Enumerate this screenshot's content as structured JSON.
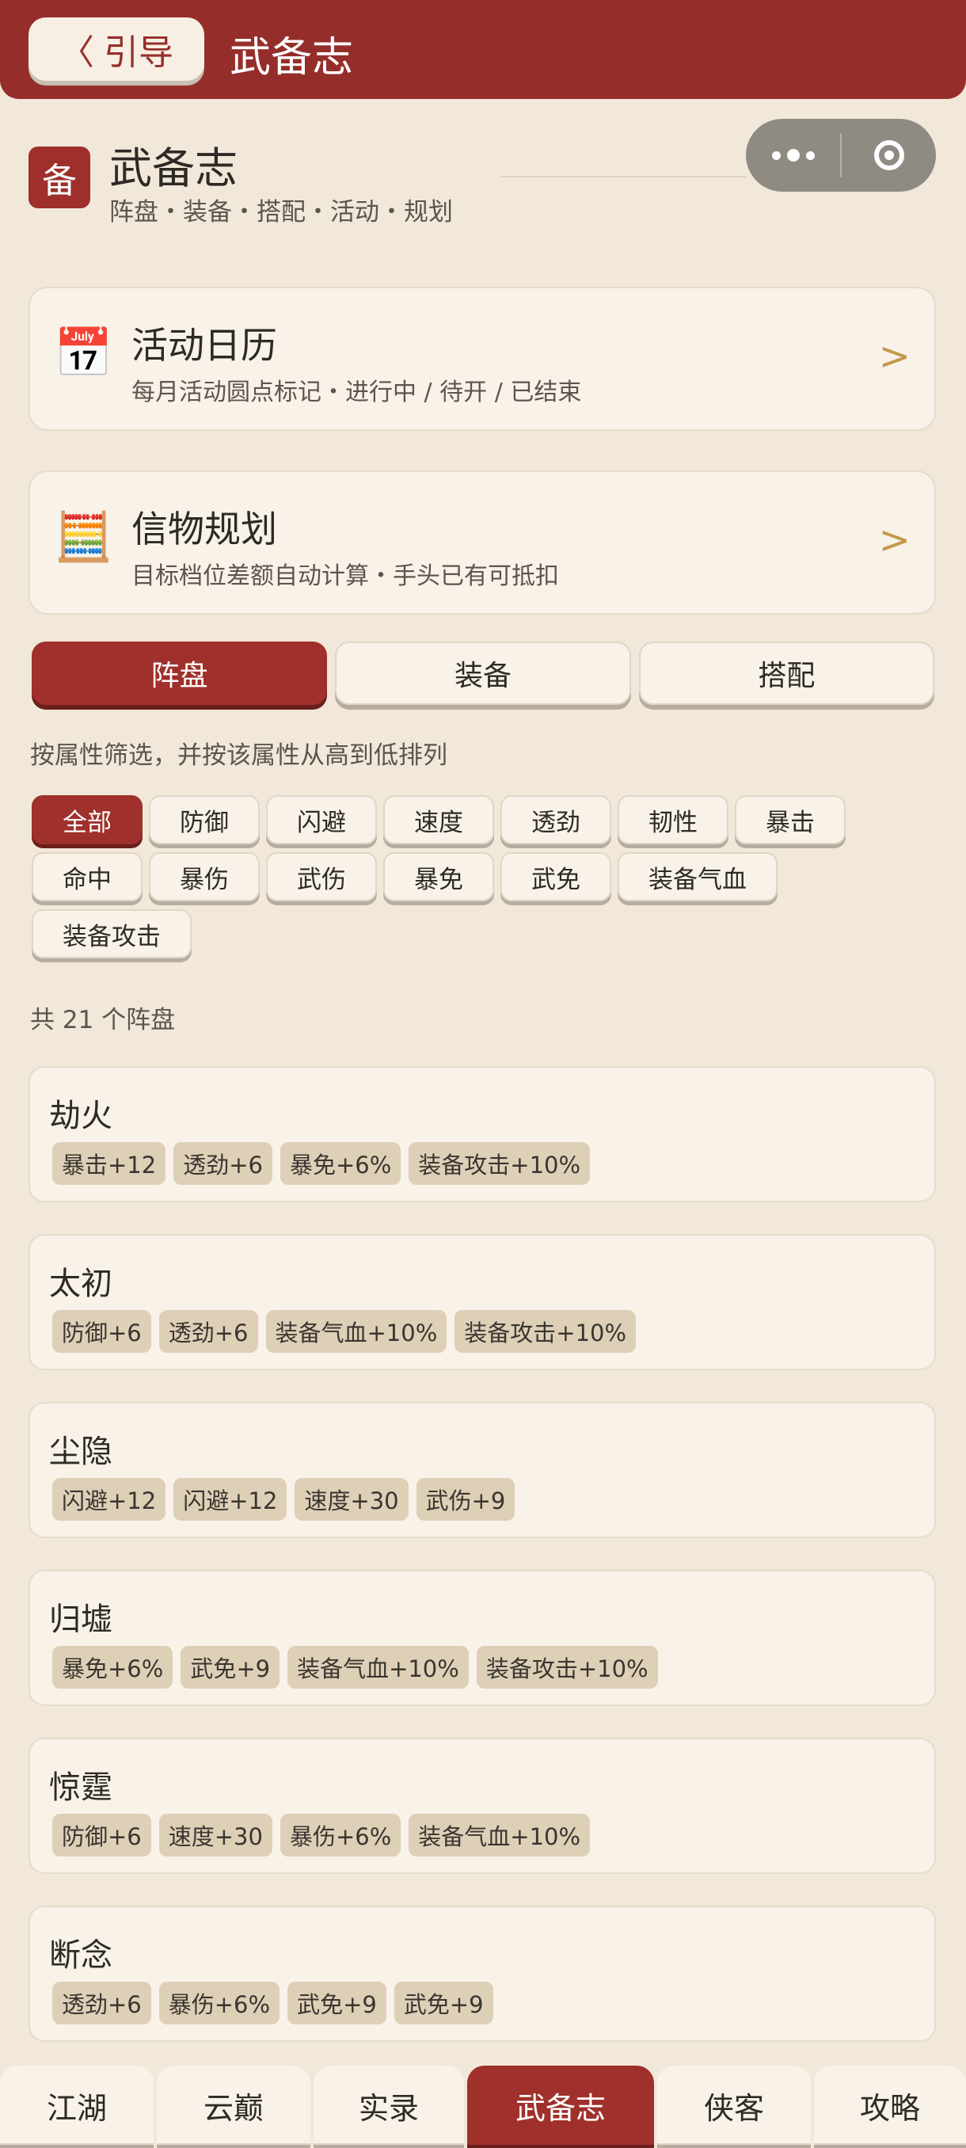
{
  "topbar": {
    "back_glyph": "〈",
    "back_label": "引导",
    "title": "武备志"
  },
  "header": {
    "logo_char": "备",
    "title": "武备志",
    "subtitle": "阵盘・装备・搭配・活动・规划"
  },
  "entries": [
    {
      "icon": "calendar-icon",
      "emoji": "📅",
      "title": "活动日历",
      "subtitle": "每月活动圆点标记・进行中 / 待开 / 已结束",
      "chevron": ">"
    },
    {
      "icon": "abacus-icon",
      "emoji": "🧮",
      "title": "信物规划",
      "subtitle": "目标档位差额自动计算・手头已有可抵扣",
      "chevron": ">"
    }
  ],
  "tabs": [
    {
      "label": "阵盘",
      "active": true
    },
    {
      "label": "装备",
      "active": false
    },
    {
      "label": "搭配",
      "active": false
    }
  ],
  "hint": "按属性筛选，并按该属性从高到低排列",
  "filters": [
    {
      "label": "全部",
      "active": true
    },
    {
      "label": "防御"
    },
    {
      "label": "闪避"
    },
    {
      "label": "速度"
    },
    {
      "label": "透劲"
    },
    {
      "label": "韧性"
    },
    {
      "label": "暴击"
    },
    {
      "label": "命中"
    },
    {
      "label": "暴伤"
    },
    {
      "label": "武伤"
    },
    {
      "label": "暴免"
    },
    {
      "label": "武免"
    },
    {
      "label": "装备气血"
    },
    {
      "label": "装备攻击"
    }
  ],
  "count_text": "共 21 个阵盘",
  "cards": [
    {
      "name": "劫火",
      "tags": [
        "暴击+12",
        "透劲+6",
        "暴免+6%",
        "装备攻击+10%"
      ]
    },
    {
      "name": "太初",
      "tags": [
        "防御+6",
        "透劲+6",
        "装备气血+10%",
        "装备攻击+10%"
      ]
    },
    {
      "name": "尘隐",
      "tags": [
        "闪避+12",
        "闪避+12",
        "速度+30",
        "武伤+9"
      ]
    },
    {
      "name": "归墟",
      "tags": [
        "暴免+6%",
        "武免+9",
        "装备气血+10%",
        "装备攻击+10%"
      ]
    },
    {
      "name": "惊霆",
      "tags": [
        "防御+6",
        "速度+30",
        "暴伤+6%",
        "装备气血+10%"
      ]
    },
    {
      "name": "断念",
      "tags": [
        "透劲+6",
        "暴伤+6%",
        "武免+9",
        "武免+9"
      ]
    }
  ],
  "bottom_nav": [
    {
      "label": "江湖"
    },
    {
      "label": "云巅"
    },
    {
      "label": "实录"
    },
    {
      "label": "武备志",
      "active": true
    },
    {
      "label": "侠客"
    },
    {
      "label": "攻略"
    }
  ],
  "colors": {
    "accent": "#a0302b",
    "topbar": "#952e2a",
    "background": "#f1e8da",
    "card": "#f8f2e8",
    "tag": "#ddd0b7",
    "chevron": "#c2994d"
  }
}
